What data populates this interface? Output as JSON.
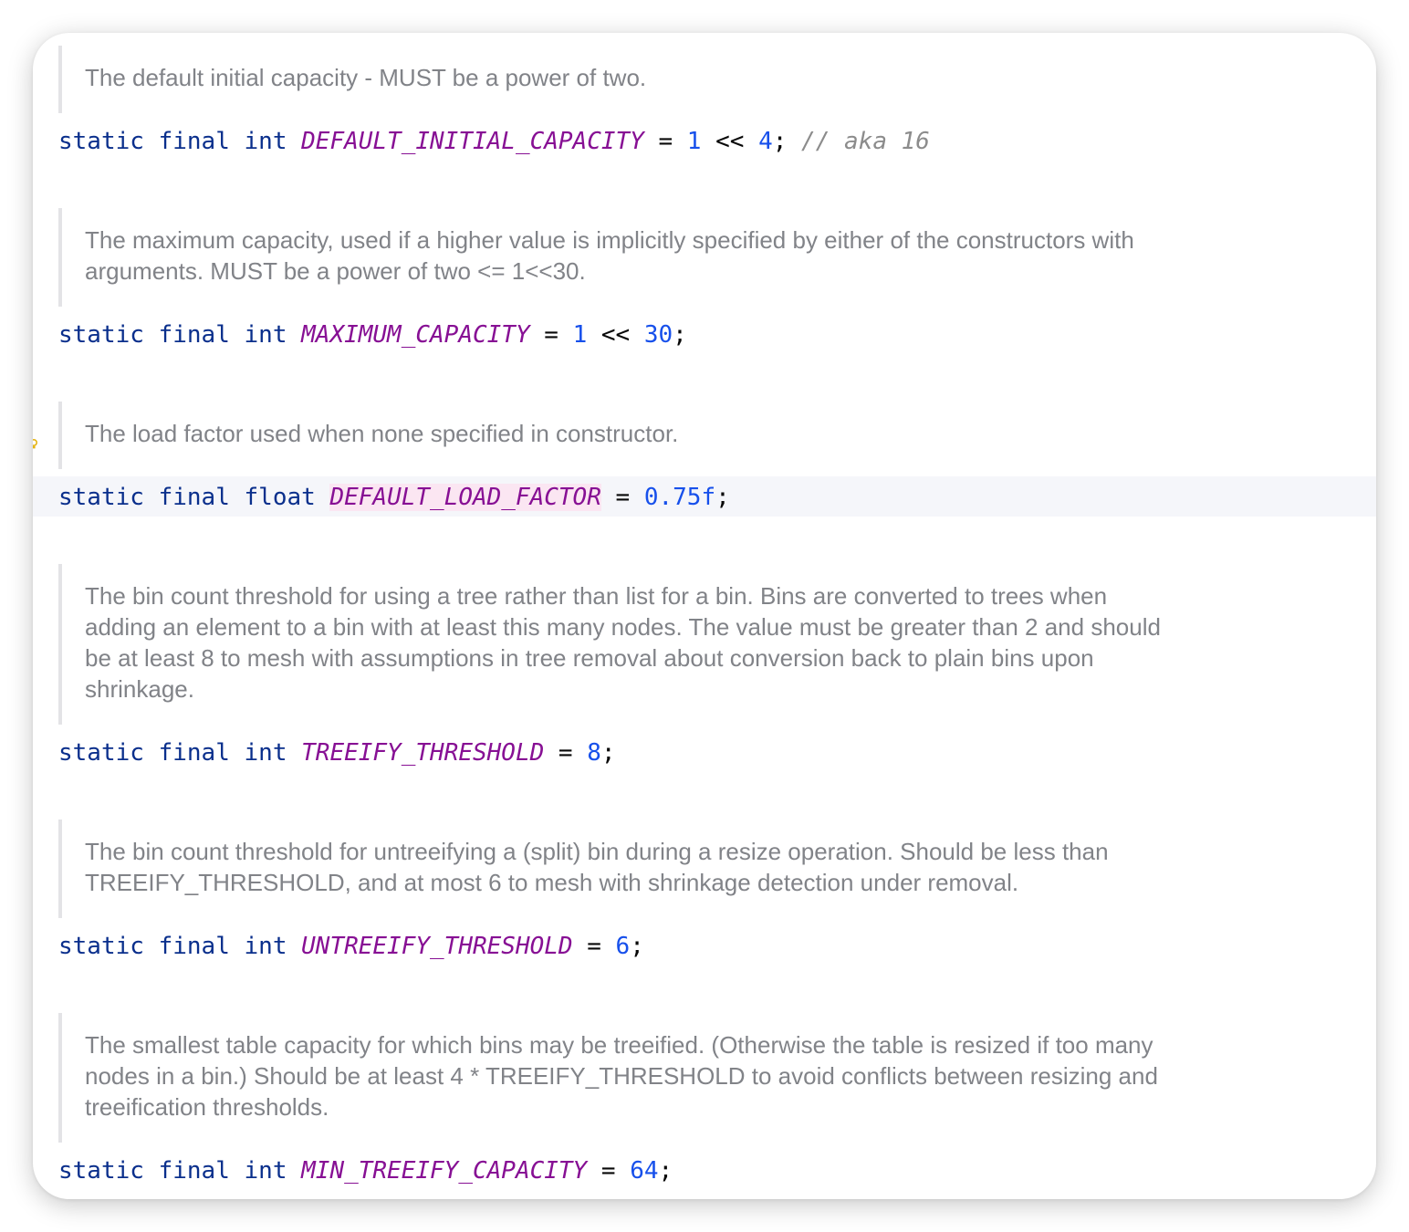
{
  "blocks": [
    {
      "doc": "The default initial capacity - MUST be a power of two.",
      "modifiers": [
        "static",
        "final"
      ],
      "type": "int",
      "name": "DEFAULT_INITIAL_CAPACITY",
      "eq": "=",
      "value_a": "1",
      "op": "<<",
      "value_b": "4",
      "semi": ";",
      "comment": "// aka 16"
    },
    {
      "doc": "The maximum capacity, used if a higher value is implicitly specified by either of the constructors with arguments. MUST be a power of two <= 1<<30.",
      "modifiers": [
        "static",
        "final"
      ],
      "type": "int",
      "name": "MAXIMUM_CAPACITY",
      "eq": "=",
      "value_a": "1",
      "op": "<<",
      "value_b": "30",
      "semi": ";"
    },
    {
      "doc": "The load factor used when none specified in constructor.",
      "modifiers": [
        "static",
        "final"
      ],
      "type": "float",
      "name": "DEFAULT_LOAD_FACTOR",
      "eq": "=",
      "value": "0.75f",
      "semi": ";",
      "current_line": true
    },
    {
      "doc": "The bin count threshold for using a tree rather than list for a bin. Bins are converted to trees when adding an element to a bin with at least this many nodes. The value must be greater than 2 and should be at least 8 to mesh with assumptions in tree removal about conversion back to plain bins upon shrinkage.",
      "modifiers": [
        "static",
        "final"
      ],
      "type": "int",
      "name": "TREEIFY_THRESHOLD",
      "eq": "=",
      "value": "8",
      "semi": ";"
    },
    {
      "doc": "The bin count threshold for untreeifying a (split) bin during a resize operation. Should be less than TREEIFY_THRESHOLD, and at most 6 to mesh with shrinkage detection under removal.",
      "modifiers": [
        "static",
        "final"
      ],
      "type": "int",
      "name": "UNTREEIFY_THRESHOLD",
      "eq": "=",
      "value": "6",
      "semi": ";"
    },
    {
      "doc": "The smallest table capacity for which bins may be treeified. (Otherwise the table is resized if too many nodes in a bin.) Should be at least 4 * TREEIFY_THRESHOLD to avoid conflicts between resizing and treeification thresholds.",
      "modifiers": [
        "static",
        "final"
      ],
      "type": "int",
      "name": "MIN_TREEIFY_CAPACITY",
      "eq": "=",
      "value": "64",
      "semi": ";"
    }
  ],
  "gutter": {
    "icon": "bulb-icon",
    "color": "#e4b413"
  },
  "colors": {
    "keyword": "#0a2f8c",
    "constant": "#871094",
    "number": "#1750eb",
    "comment": "#8c8c8c",
    "doc_text": "#818388",
    "current_line_bg": "#f5f6fa",
    "identifier_highlight_bg": "#fbe6f2"
  }
}
